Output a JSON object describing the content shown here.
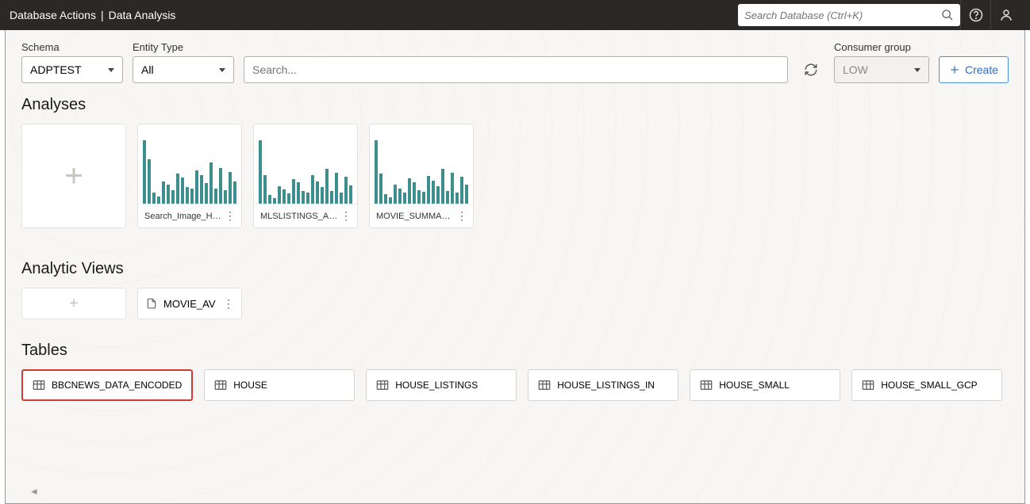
{
  "header": {
    "app": "Database Actions",
    "page": "Data Analysis",
    "search_placeholder": "Search Database (Ctrl+K)"
  },
  "filters": {
    "schema_label": "Schema",
    "schema_value": "ADPTEST",
    "entity_label": "Entity Type",
    "entity_value": "All",
    "search_placeholder": "Search...",
    "consumer_label": "Consumer group",
    "consumer_value": "LOW",
    "create_label": "Create"
  },
  "sections": {
    "analyses": "Analyses",
    "analytic_views": "Analytic Views",
    "tables": "Tables"
  },
  "analyses": [
    {
      "name": "Search_Image_Hug..."
    },
    {
      "name": "MLSLISTINGS_ANA..."
    },
    {
      "name": "MOVIE_SUMMARY..."
    }
  ],
  "analytic_views": [
    {
      "name": "MOVIE_AV"
    }
  ],
  "tables": [
    {
      "name": "BBCNEWS_DATA_ENCODED",
      "selected": true
    },
    {
      "name": "HOUSE"
    },
    {
      "name": "HOUSE_LISTINGS"
    },
    {
      "name": "HOUSE_LISTINGS_IN"
    },
    {
      "name": "HOUSE_SMALL"
    },
    {
      "name": "HOUSE_SMALL_GCP"
    }
  ],
  "chart_data": [
    {
      "type": "bar",
      "values": [
        85,
        60,
        15,
        10,
        30,
        25,
        18,
        40,
        35,
        22,
        20,
        45,
        38,
        28,
        55,
        20,
        48,
        18,
        42,
        30
      ]
    },
    {
      "type": "bar",
      "values": [
        90,
        40,
        12,
        8,
        25,
        20,
        15,
        35,
        30,
        18,
        16,
        40,
        32,
        24,
        50,
        18,
        44,
        16,
        38,
        26
      ]
    },
    {
      "type": "bar",
      "values": [
        95,
        45,
        14,
        9,
        28,
        22,
        17,
        38,
        32,
        20,
        18,
        42,
        34,
        26,
        52,
        19,
        46,
        17,
        40,
        28
      ]
    }
  ]
}
